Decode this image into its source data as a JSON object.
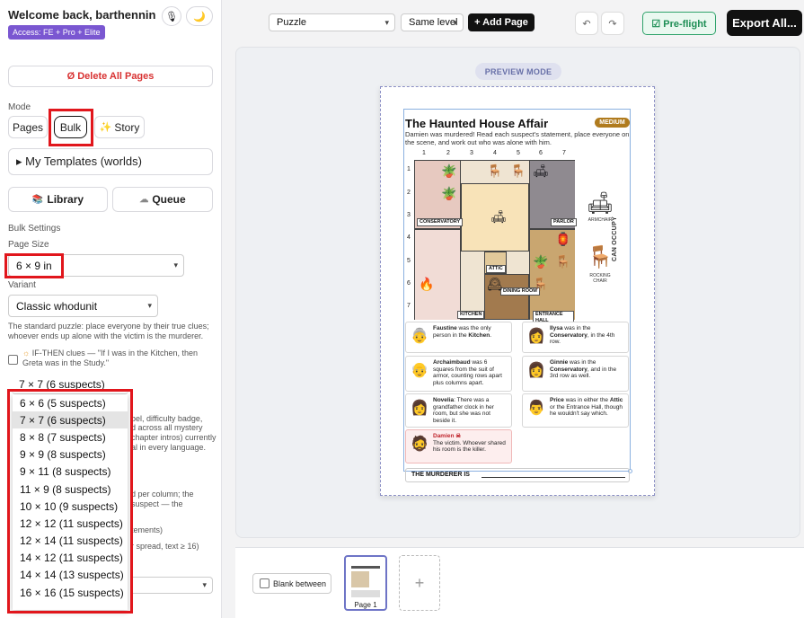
{
  "sidebar": {
    "welcome": "Welcome back, barthennin",
    "access_badge": "Access: FE + Pro + Elite",
    "mic_icon": "🎙",
    "theme_icon": "🌙",
    "delete_label": "Ø Delete All Pages",
    "mode_label": "Mode",
    "modes": [
      "Pages",
      "Bulk",
      "Story"
    ],
    "story_icon": "✨",
    "templates_label": "▸  My Templates (worlds)",
    "library_label": "Library",
    "library_icon": "📚",
    "queue_label": "Queue",
    "queue_icon": "☁",
    "bulk_settings": "Bulk Settings",
    "page_size_label": "Page Size",
    "page_size": "6 × 9 in",
    "variant_label": "Variant",
    "variant": "Classic whodunit",
    "variant_desc": "The standard puzzle: place everyone by their true clues; whoever ends up alone with the victim is the murderer.",
    "ifthen_label": "IF-THEN clues — \"If I was in the Kitchen, then Greta was in the Study.\"",
    "grid_size": "7 × 7 (6 suspects)",
    "hidden_frags": [
      "bel, difficulty badge,",
      "d across all mystery",
      "chapter intros) currently",
      "al in every language.",
      "d per column; the",
      "suspect — the",
      "tements)",
      "r spread, text ≥ 16)"
    ],
    "grid_options": [
      "6 × 6 (5 suspects)",
      "7 × 7 (6 suspects)",
      "8 × 8 (7 suspects)",
      "9 × 9 (8 suspects)",
      "9 × 11 (8 suspects)",
      "11 × 9 (8 suspects)",
      "10 × 10 (9 suspects)",
      "12 × 12 (11 suspects)",
      "12 × 14 (11 suspects)",
      "14 × 12 (11 suspects)",
      "14 × 14 (13 suspects)",
      "16 × 16 (15 suspects)"
    ]
  },
  "toolbar": {
    "template_select": "Puzzle",
    "level_select": "Same level",
    "add_page": "+ Add Page",
    "undo_icon": "↶",
    "redo_icon": "↷",
    "preflight": "☑ Pre-flight",
    "export": "Export All..."
  },
  "canvas": {
    "preview_mode": "PREVIEW MODE"
  },
  "puzzle": {
    "title": "The Haunted House Affair",
    "difficulty": "MEDIUM",
    "intro": "Damien was murdered! Read each suspect's statement, place everyone on the scene, and work out who was alone with him.",
    "columns": [
      "1",
      "2",
      "3",
      "4",
      "5",
      "6",
      "7"
    ],
    "rows": [
      "1",
      "2",
      "3",
      "4",
      "5",
      "6",
      "7"
    ],
    "rooms": [
      "CONSERVATORY",
      "PARLOR",
      "ATTIC",
      "DINING ROOM",
      "KITCHEN",
      "ENTRANCE HALL"
    ],
    "side_items": [
      "ARMCHAIR",
      "ROCKING CHAIR"
    ],
    "can_occupy": "CAN OCCUPY",
    "clues": [
      {
        "name": "Faustine",
        "text": " was the only person in the ",
        "bold": "Kitchen",
        "end": "."
      },
      {
        "name": "Ilysa",
        "text": " was in the ",
        "bold": "Conservatory",
        "end": ", in the 4th row."
      },
      {
        "name": "Archaimbaud",
        "text": " was 6 squares from the suit of armor, counting rows apart plus columns apart.",
        "bold": "",
        "end": ""
      },
      {
        "name": "Ginnie",
        "text": " was in the ",
        "bold": "Conservatory",
        "end": ", and in the 3rd row as well."
      },
      {
        "name": "Novelia",
        "text": ": There was a grandfather clock in her room, but she was not beside it.",
        "bold": "",
        "end": ""
      },
      {
        "name": "Price",
        "text": " was in either the ",
        "bold": "Attic",
        "end": " or the Entrance Hall, though he wouldn't say which."
      }
    ],
    "victim_name": "Damien ☠",
    "victim_text": "The victim. Whoever shared his room is the killer.",
    "murderer_label": "THE MURDERER IS"
  },
  "bottom": {
    "blank_between": "Blank between",
    "page_label": "Page 1",
    "add_icon": "+"
  },
  "colors": {
    "accent_red": "#e1161c",
    "badge_purple": "#7a57d1",
    "preflight_green": "#1e8e55"
  }
}
